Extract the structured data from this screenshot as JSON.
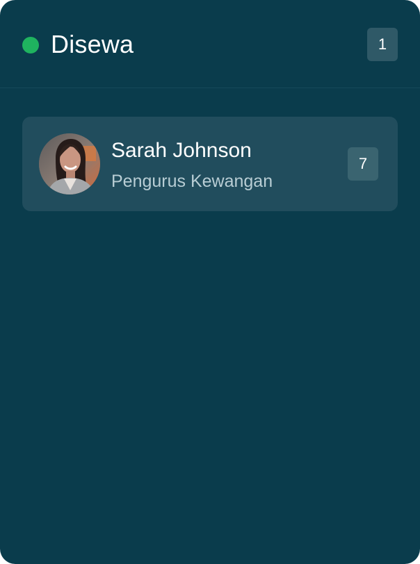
{
  "column": {
    "title": "Disewa",
    "count": "1",
    "status_color": "#1fb35f"
  },
  "cards": [
    {
      "name": "Sarah Johnson",
      "role": "Pengurus Kewangan",
      "count": "7",
      "avatar_icon": "person-photo"
    }
  ]
}
